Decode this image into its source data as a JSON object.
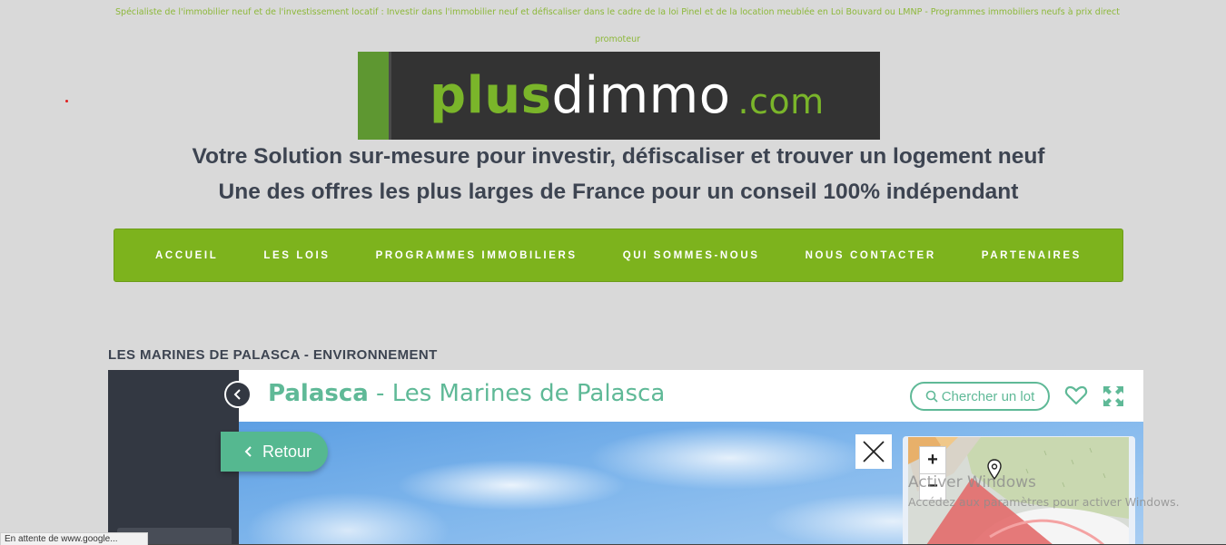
{
  "page": {
    "tagline_line1": "Spécialiste de l'immobilier neuf et de l'investissement locatif : Investir dans l'immobilier neuf et défiscaliser dans le cadre de la loi Pinel et de la location meublée en Loi Bouvard ou LMNP - Programmes immobiliers neufs à prix direct",
    "tagline_line2": "promoteur"
  },
  "logo": {
    "part1": "plus",
    "part2": "dimmo",
    "part3": ".com"
  },
  "headlines": {
    "line1": "Votre Solution sur-mesure pour investir, défiscaliser et trouver un logement neuf",
    "line2": "Une des offres les plus larges de France pour un conseil 100% indépendant"
  },
  "nav": {
    "items": [
      {
        "label": "ACCUEIL"
      },
      {
        "label": "LES LOIS"
      },
      {
        "label": "PROGRAMMES IMMOBILIERS"
      },
      {
        "label": "QUI SOMMES-NOUS"
      },
      {
        "label": "NOUS CONTACTER"
      },
      {
        "label": "PARTENAIRES"
      }
    ]
  },
  "section": {
    "title": "LES MARINES DE PALASCA - ENVIRONNEMENT"
  },
  "viewer": {
    "city": "Palasca",
    "separator": " - ",
    "project": "Les Marines de Palasca",
    "search_label": "Chercher un lot",
    "back_label": "Retour",
    "zoom_in": "+",
    "zoom_out": "−"
  },
  "overlay": {
    "watermark_title": "Activer Windows",
    "watermark_sub": "Accédez aux paramètres pour activer Windows."
  },
  "status": {
    "text": "En attente de www.google..."
  },
  "colors": {
    "brand_green": "#7db31d",
    "viewer_accent": "#5fb997",
    "heading_text": "#3d4451"
  }
}
